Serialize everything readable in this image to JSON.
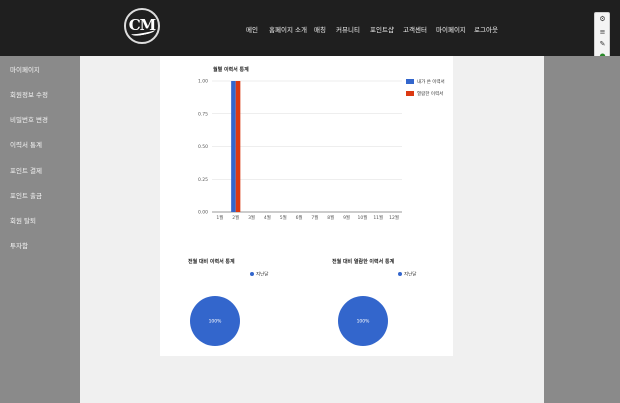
{
  "nav": {
    "logo_text": "CM",
    "items": [
      "메인",
      "홈페이지 소개",
      "매칭",
      "커뮤니티",
      "포인트샵",
      "고객센터",
      "마이페이지",
      "로그아웃"
    ]
  },
  "sidebar": {
    "items": [
      "마이페이지",
      "회원정보 수정",
      "비밀번호 변경",
      "이력서 통계",
      "포인트 결제",
      "포인트 출금",
      "회원 탈퇴",
      "투자함"
    ]
  },
  "colors": {
    "blue": "#3366cc",
    "red": "#dc3912",
    "topbar": "#1f1f1f",
    "sidebar": "#8a8a8a"
  },
  "chart_data": [
    {
      "type": "bar",
      "title": "월별 이력서 통계",
      "categories": [
        "1월",
        "2월",
        "3월",
        "4월",
        "5월",
        "6월",
        "7월",
        "8월",
        "9월",
        "10월",
        "11월",
        "12월"
      ],
      "series": [
        {
          "name": "내가 쓴 이력서",
          "color": "#3366cc",
          "values": [
            0,
            1,
            0,
            0,
            0,
            0,
            0,
            0,
            0,
            0,
            0,
            0
          ]
        },
        {
          "name": "열람한 이력서",
          "color": "#dc3912",
          "values": [
            0,
            1,
            0,
            0,
            0,
            0,
            0,
            0,
            0,
            0,
            0,
            0
          ]
        }
      ],
      "yticks": [
        "0.00",
        "0.25",
        "0.50",
        "0.75",
        "1.00"
      ],
      "ylim": [
        0,
        1
      ],
      "legend": "right"
    },
    {
      "type": "pie",
      "title": "전월 대비 이력서 통계",
      "slices": [
        {
          "label": "지난달",
          "value": 100,
          "color": "#3366cc",
          "text": "100%"
        }
      ],
      "legend": "right"
    },
    {
      "type": "pie",
      "title": "전월 대비 열람한 이력서 통계",
      "slices": [
        {
          "label": "지난달",
          "value": 100,
          "color": "#3366cc",
          "text": "100%"
        }
      ],
      "legend": "right"
    }
  ]
}
